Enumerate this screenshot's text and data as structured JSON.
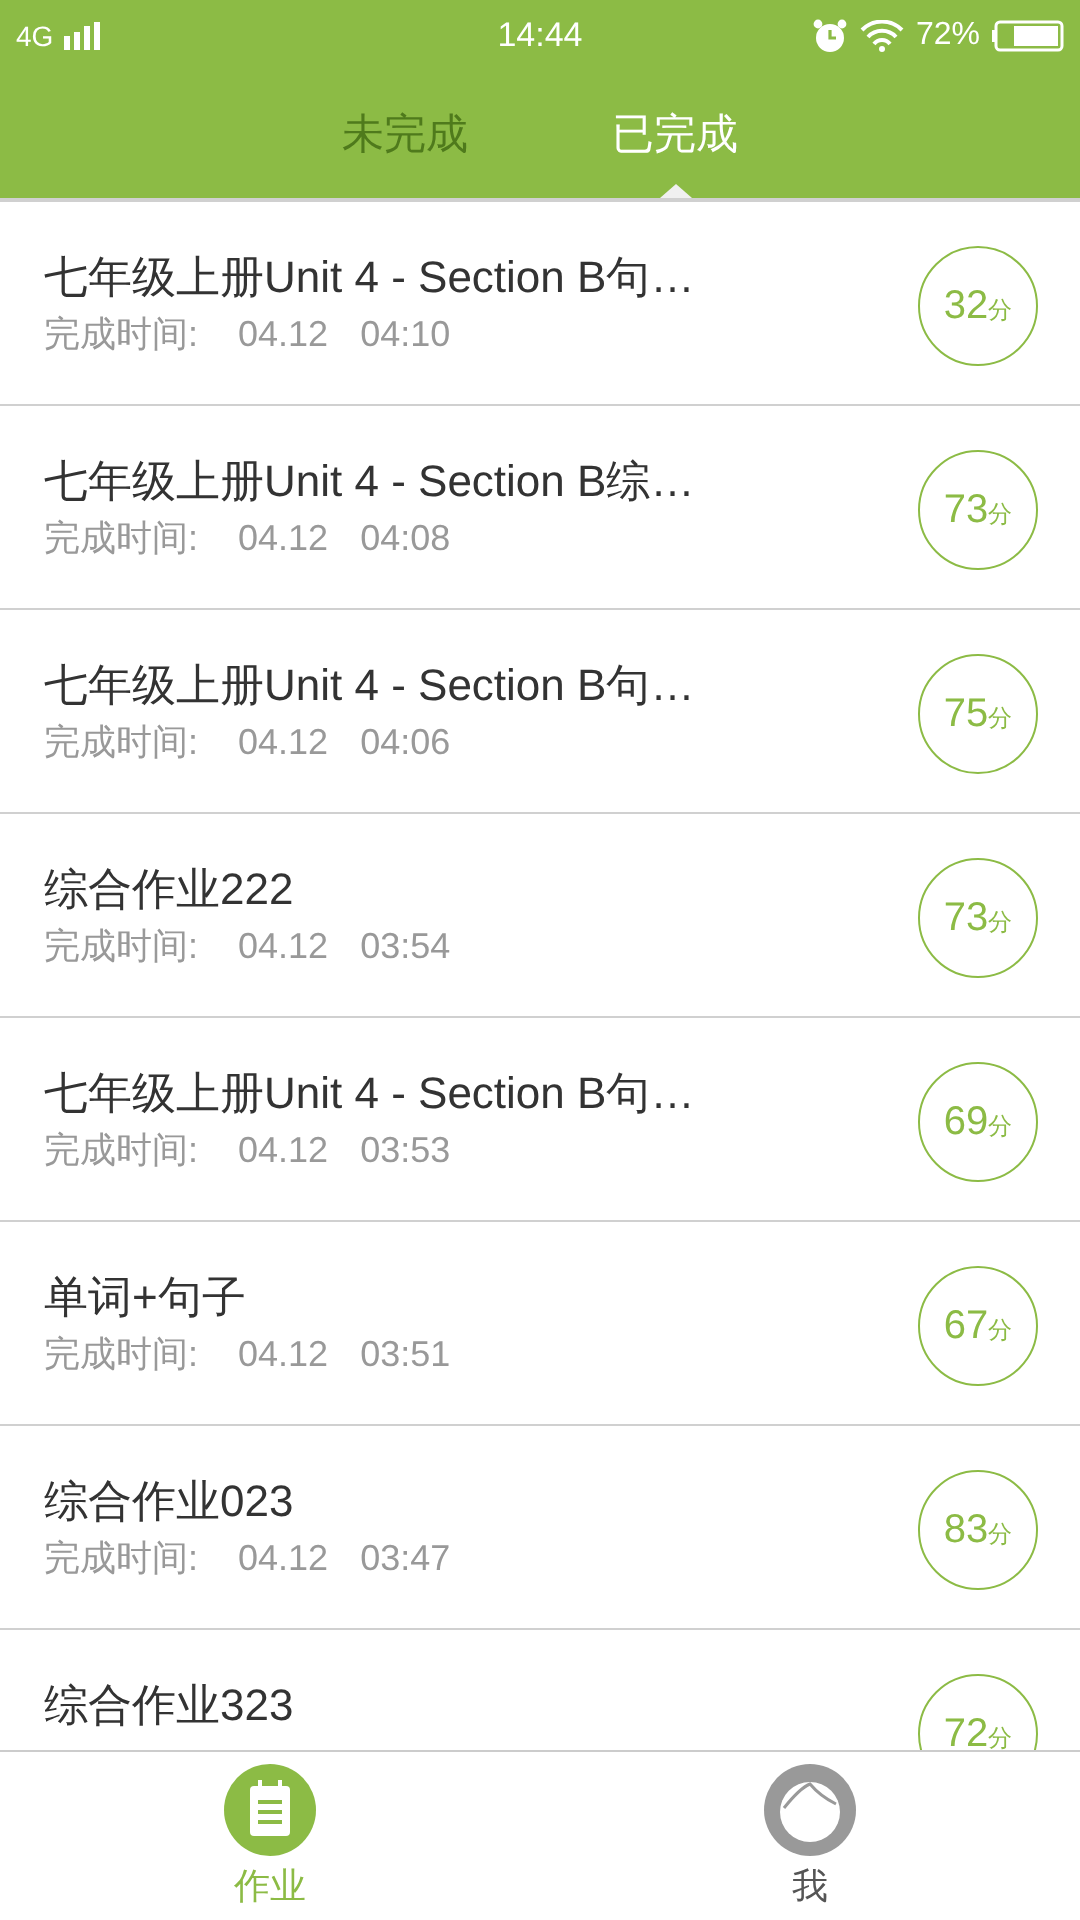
{
  "status_bar": {
    "network": "4G",
    "time": "14:44",
    "battery": "72%"
  },
  "tabs": [
    {
      "label": "未完成",
      "selected": false
    },
    {
      "label": "已完成",
      "selected": true
    }
  ],
  "items": [
    {
      "title": "七年级上册Unit 4 - Section B句…",
      "label": "完成时间:",
      "date": "04.12",
      "time": "04:10",
      "score": "32",
      "unit": "分"
    },
    {
      "title": "七年级上册Unit 4 - Section B综…",
      "label": "完成时间:",
      "date": "04.12",
      "time": "04:08",
      "score": "73",
      "unit": "分"
    },
    {
      "title": "七年级上册Unit 4 - Section B句…",
      "label": "完成时间:",
      "date": "04.12",
      "time": "04:06",
      "score": "75",
      "unit": "分"
    },
    {
      "title": "综合作业222",
      "label": "完成时间:",
      "date": "04.12",
      "time": "03:54",
      "score": "73",
      "unit": "分"
    },
    {
      "title": "七年级上册Unit 4 - Section B句…",
      "label": "完成时间:",
      "date": "04.12",
      "time": "03:53",
      "score": "69",
      "unit": "分"
    },
    {
      "title": "单词+句子",
      "label": "完成时间:",
      "date": "04.12",
      "time": "03:51",
      "score": "67",
      "unit": "分"
    },
    {
      "title": "综合作业023",
      "label": "完成时间:",
      "date": "04.12",
      "time": "03:47",
      "score": "83",
      "unit": "分"
    },
    {
      "title": "综合作业323",
      "score": "72",
      "unit": "分"
    }
  ],
  "bottom_nav": [
    {
      "label": "作业",
      "kind": "homework",
      "selected": true
    },
    {
      "label": "我",
      "kind": "profile",
      "selected": false
    }
  ]
}
